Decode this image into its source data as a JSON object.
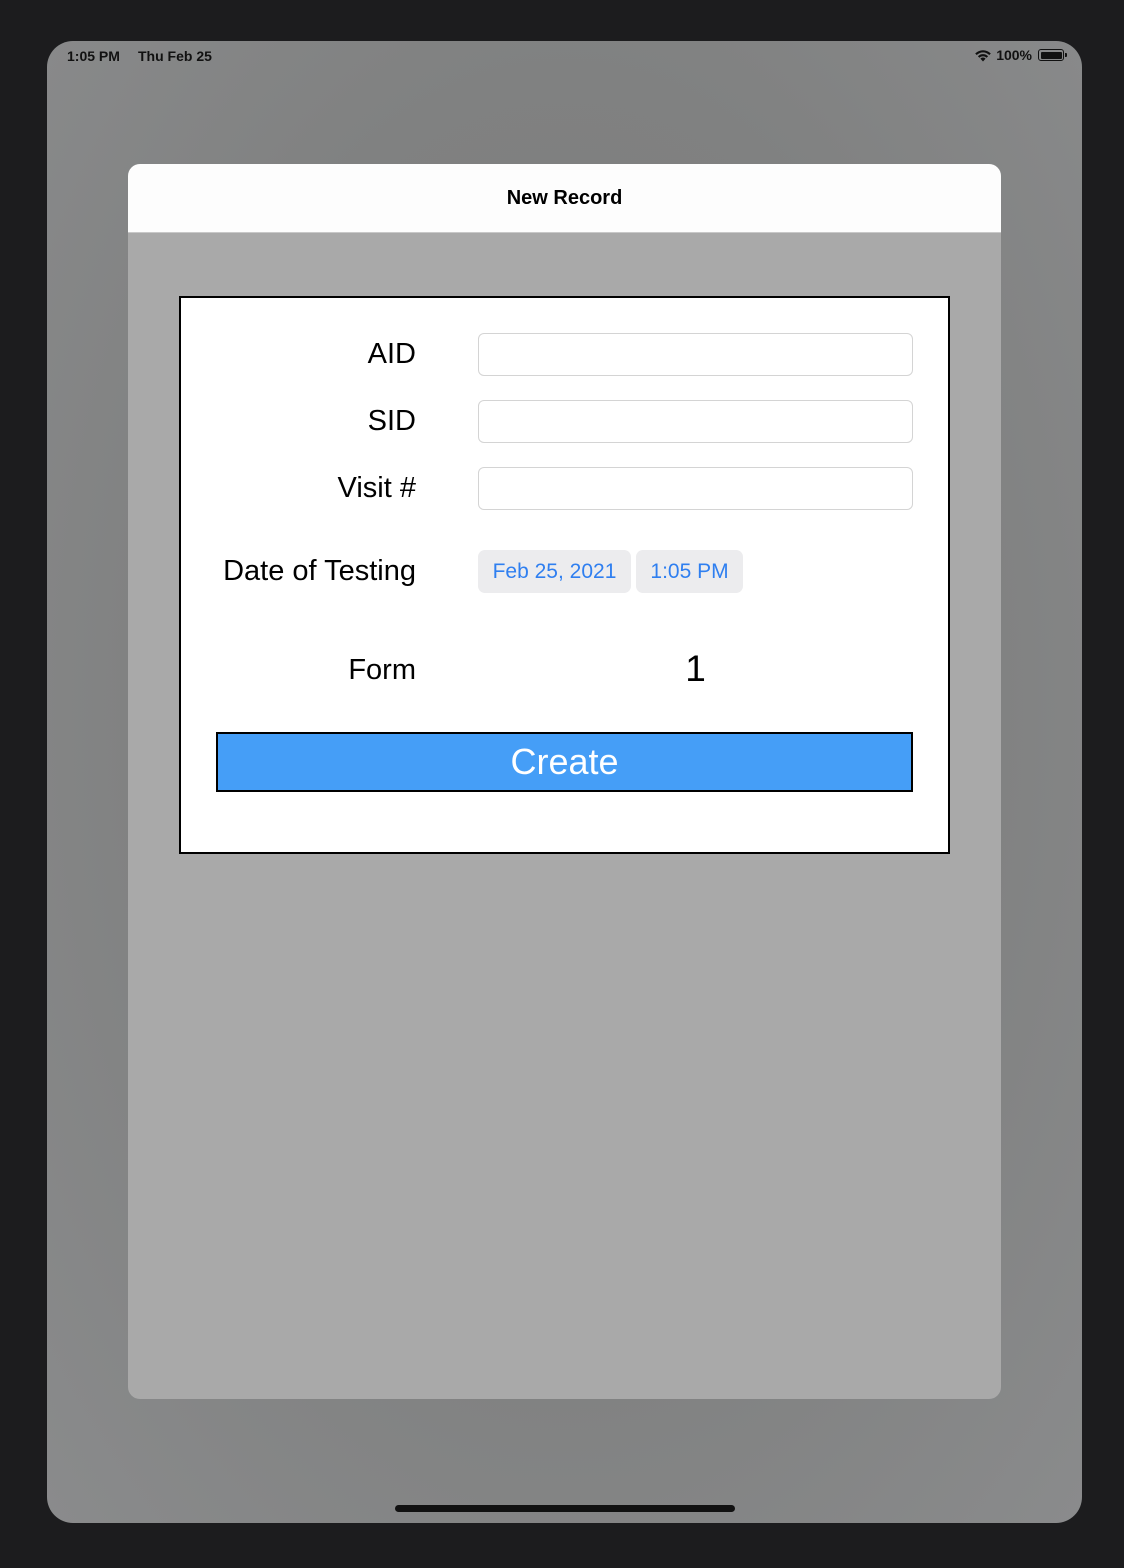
{
  "status_bar": {
    "time": "1:05 PM",
    "date": "Thu Feb 25",
    "battery_percent": "100%",
    "battery_level": 1.0,
    "icons": [
      "wifi-icon",
      "battery-icon"
    ]
  },
  "sheet": {
    "title": "New Record"
  },
  "form": {
    "fields": [
      {
        "label": "AID",
        "value": "",
        "placeholder": ""
      },
      {
        "label": "SID",
        "value": "",
        "placeholder": ""
      },
      {
        "label": "Visit #",
        "value": "",
        "placeholder": ""
      }
    ],
    "date_of_testing": {
      "label": "Date of Testing",
      "date": "Feb 25, 2021",
      "time": "1:05 PM"
    },
    "form_number": {
      "label": "Form",
      "value": "1"
    },
    "create_label": "Create"
  },
  "colors": {
    "accent": "#2f7ff0",
    "button": "#459ef7",
    "sheet_background": "#a9a9a9"
  }
}
